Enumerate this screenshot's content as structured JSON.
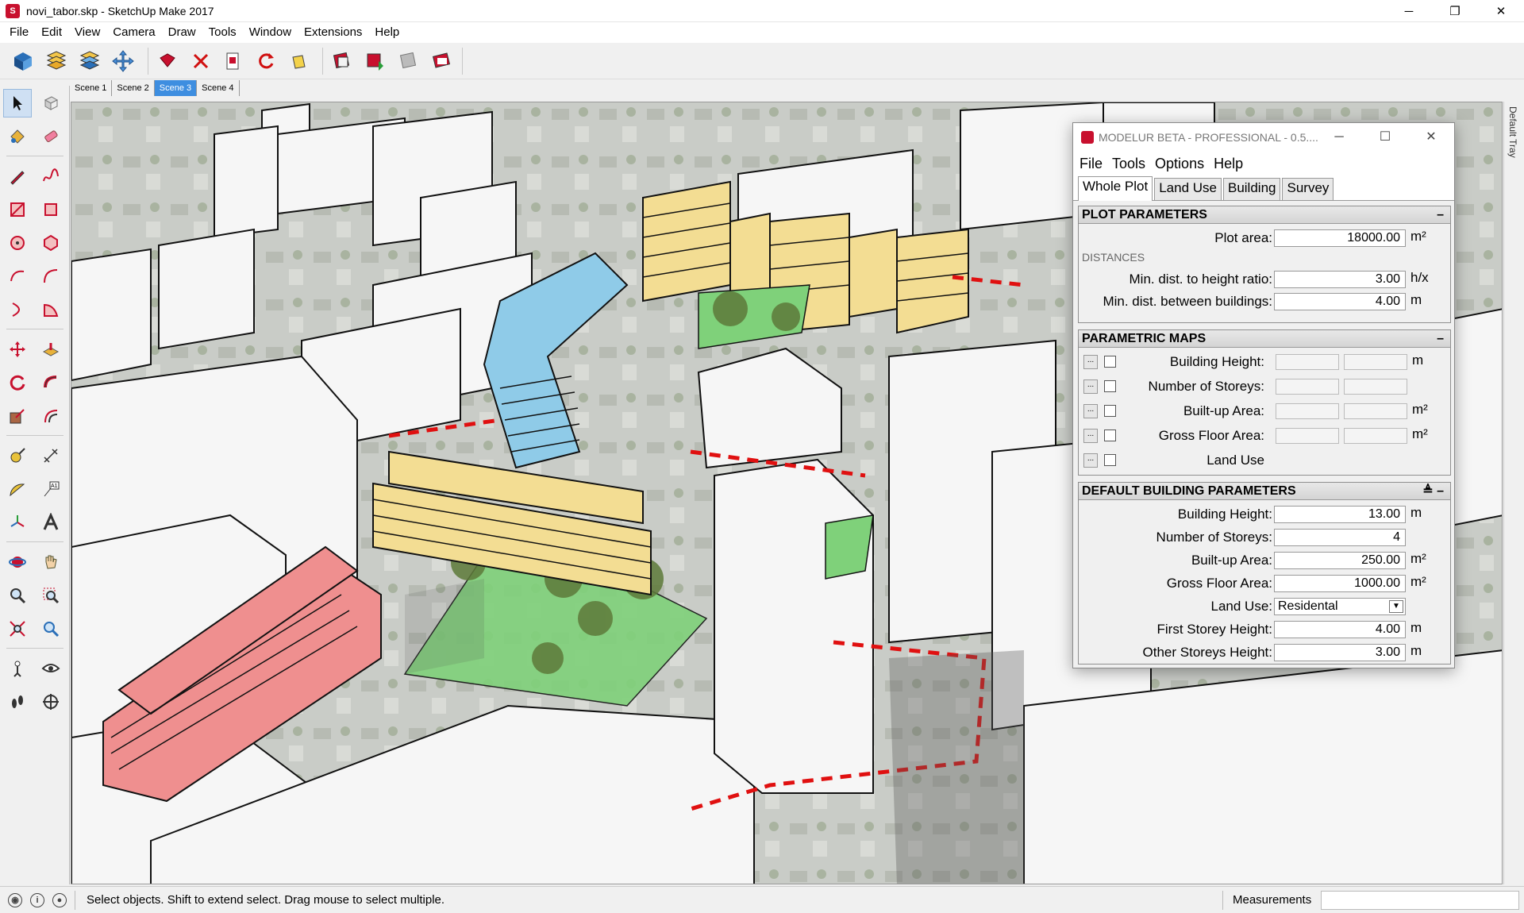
{
  "window": {
    "title": "novi_tabor.skp - SketchUp Make 2017",
    "controls": [
      "─",
      "❐",
      "✕"
    ]
  },
  "menu": [
    "File",
    "Edit",
    "View",
    "Camera",
    "Draw",
    "Tools",
    "Window",
    "Extensions",
    "Help"
  ],
  "scenes": [
    "Scene 1",
    "Scene 2",
    "Scene 3",
    "Scene 4"
  ],
  "active_scene": "Scene 3",
  "tray": {
    "label": "Default Tray"
  },
  "status": {
    "hint": "Select objects. Shift to extend select. Drag mouse to select multiple.",
    "measurements_label": "Measurements"
  },
  "panel": {
    "title": "MODELUR BETA - PROFESSIONAL - 0.5....",
    "menu": [
      "File",
      "Tools",
      "Options",
      "Help"
    ],
    "tabs": [
      "Whole Plot",
      "Land Use",
      "Building",
      "Survey"
    ],
    "active_tab": "Whole Plot",
    "plot": {
      "header": "PLOT PARAMETERS",
      "plot_area_label": "Plot area:",
      "plot_area": "18000.00",
      "plot_area_unit": "m²",
      "distances_label": "DISTANCES",
      "min_height_ratio_label": "Min. dist. to height ratio:",
      "min_height_ratio": "3.00",
      "min_height_ratio_unit": "h/x",
      "min_between_label": "Min. dist. between buildings:",
      "min_between": "4.00",
      "min_between_unit": "m"
    },
    "maps": {
      "header": "PARAMETRIC MAPS",
      "dots": "...",
      "rows": [
        {
          "label": "Building Height:",
          "unit": "m"
        },
        {
          "label": "Number of Storeys:",
          "unit": ""
        },
        {
          "label": "Built-up Area:",
          "unit": "m²"
        },
        {
          "label": "Gross Floor Area:",
          "unit": "m²"
        },
        {
          "label": "Land Use",
          "unit": ""
        }
      ]
    },
    "building": {
      "header": "DEFAULT BUILDING PARAMETERS",
      "rows": [
        {
          "label": "Building Height:",
          "value": "13.00",
          "unit": "m"
        },
        {
          "label": "Number of Storeys:",
          "value": "4",
          "unit": ""
        },
        {
          "label": "Built-up Area:",
          "value": "250.00",
          "unit": "m²"
        },
        {
          "label": "Gross Floor Area:",
          "value": "1000.00",
          "unit": "m²"
        }
      ],
      "land_use_label": "Land Use:",
      "land_use": "Residental",
      "rows2": [
        {
          "label": "First Storey Height:",
          "value": "4.00",
          "unit": "m"
        },
        {
          "label": "Other Storeys Height:",
          "value": "3.00",
          "unit": "m"
        }
      ]
    }
  },
  "colors": {
    "highlight_blue": "#3e8ee0",
    "building_yellow": "#f3dd93",
    "building_blue": "#8fcbe8",
    "building_red": "#ef8f8f",
    "grass_green": "#7fd17a",
    "boundary_red": "#e01010"
  }
}
